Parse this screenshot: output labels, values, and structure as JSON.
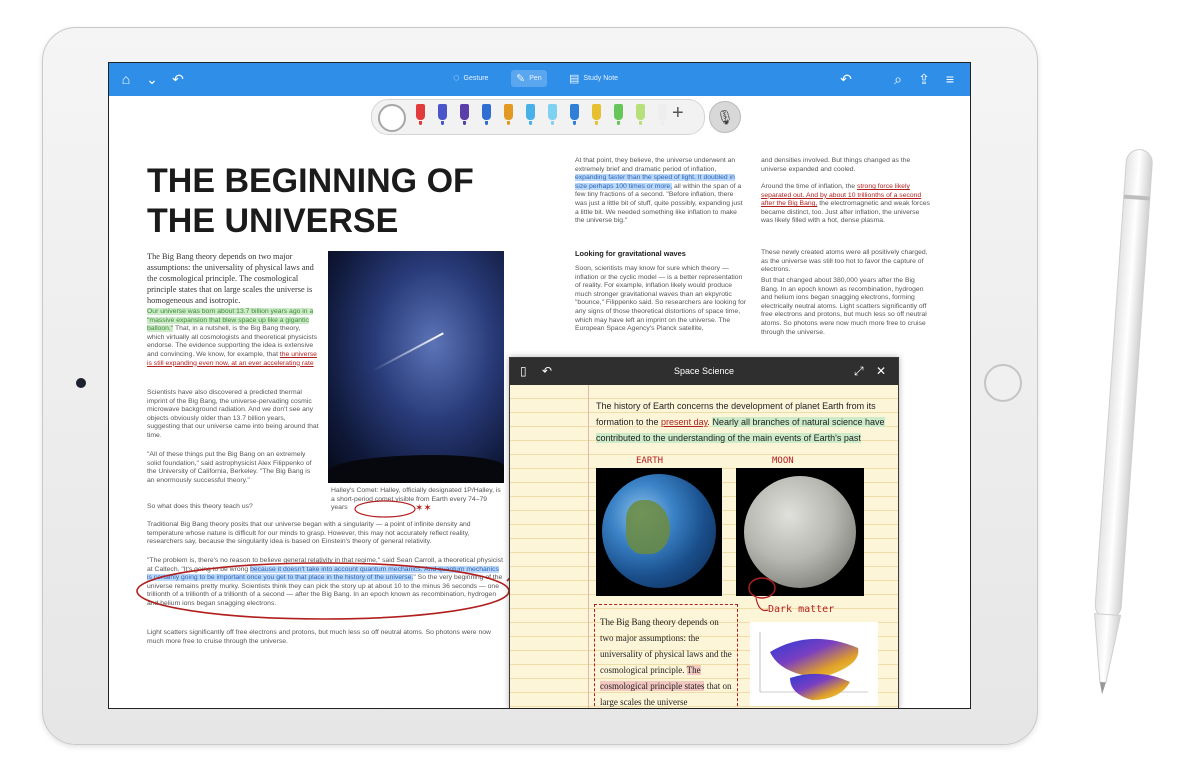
{
  "toolbar": {
    "gesture": "Gesture",
    "pen": "Pen",
    "study_note": "Study Note"
  },
  "article": {
    "title_line1": "THE BEGINNING OF",
    "title_line2": "THE UNIVERSE",
    "intro": "The Big Bang theory depends on two major assumptions: the universality of physical laws and the cosmological principle. The cosmological principle states that on large scales the universe is homogeneous and isotropic.",
    "p1_green": "Our universe was born about 13.7 billion years ago in a \"massive expansion that blew space up like a gigantic balloon.\"",
    "p1_mid": " That, in a nutshell, is the Big Bang theory, which virtually all cosmologists and theoretical physicists endorse. The evidence supporting the idea is extensive and convincing. We know, for example, that ",
    "p1_red": "the universe is still expanding even now, at an ever accelerating rate",
    "p2": "Scientists have also discovered a predicted thermal imprint of the Big Bang, the universe-pervading cosmic microwave background radiation. And we don't see any objects obviously older than 13.7 billion years, suggesting that our universe came into being around that time.",
    "p3": "\"All of these things put the Big Bang on an extremely solid foundation,\" said astrophysicist Alex Filippenko of the University of California, Berkeley. \"The Big Bang is an enormously successful theory.\"",
    "p4": "So what does this theory teach us?",
    "p5": "Traditional Big Bang theory posits that our universe began with a singularity — a point of infinite density and temperature whose nature is difficult for our minds to grasp. However, this may not accurately reflect reality, researchers say, because the singularity idea is based on Einstein's theory of general relativity.",
    "p6_a": "\"The problem is, there's no reason to believe general relativity in that regime,\" said Sean Carroll, a theoretical physicist at Caltech. \"It's going to be wrong ",
    "p6_blue": "because it doesn't take into account quantum mechanics. And quantum mechanics is certainly going to be important once you get to that place in the history of the universe.",
    "p6_b": "\" So the very beginning of the universe remains pretty murky. Scientists think they can pick the story up at about 10 to the minus 36 seconds — one trillionth of a trillionth of a trillionth of a second — after the Big Bang. In an epoch known as recombination, hydrogen and helium ions began snagging electrons.",
    "p7": "Light scatters significantly off free electrons and protons, but much less so off neutral atoms. So photons were now much more free to cruise through the universe.",
    "caption": "Halley's Comet: Halley, officially designated 1P/Halley, is a short-period comet visible from Earth every 74–79 years",
    "col2_a": "At that point, they believe, the universe underwent an extremely brief and dramatic period of inflation, ",
    "col2_blue": "expanding faster than the speed of light. It doubled in size perhaps 100 times or more,",
    "col2_b": " all within the span of a few tiny fractions of a second. \"Before inflation, there was just a little bit of stuff, quite possibly, expanding just a little bit. We needed something like inflation to make the universe big.\"",
    "col2_heading": "Looking for gravitational waves",
    "col2_c": "Soon, scientists may know for sure which theory — inflation or the cyclic model — is a better representation of reality. For example, inflation likely would produce much stronger gravitational waves than an ekpyrotic \"bounce,\" Filippenko said. So researchers are looking for any signs of those theoretical distortions of space time, which may have left an imprint on the universe. The European Space Agency's Planck satellite,",
    "col3_a": "and densities involved. But things changed as the universe expanded and cooled.",
    "col3_b": "Around the time of inflation, the ",
    "col3_red": "strong force likely separated out. And by about 10 trillionths of a second after the Big Bang,",
    "col3_c": " the electromagnetic and weak forces became distinct, too. Just after inflation, the universe was likely filled with a hot, dense plasma.",
    "col3_d": "These newly created atoms were all positively charged, as the universe was still too hot to favor the capture of electrons.",
    "col3_e": "But that changed about 380,000 years after the Big Bang. In an epoch known as recombination, hydrogen and helium ions began snagging electrons, forming electrically neutral atoms. Light scatters significantly off free electrons and protons, but much less so off neutral atoms. So photons were now much more free to cruise through the universe."
  },
  "note": {
    "title": "Space Science",
    "line_a": "The history of Earth concerns the development of planet Earth from its formation to the ",
    "present_day": "present day",
    "line_b": ". ",
    "green": "Nearly all branches of natural science have contributed to the understanding of the main events of Earth's past",
    "earth_label": "EARTH",
    "moon_label": "MOON",
    "dark_matter": "Dark matter",
    "box_a": "The Big Bang theory depends on two major assumptions: the universality of physical laws and the cosmological principle. ",
    "box_red": "The cosmological principle states",
    "box_b": " that on large scales the universe"
  }
}
